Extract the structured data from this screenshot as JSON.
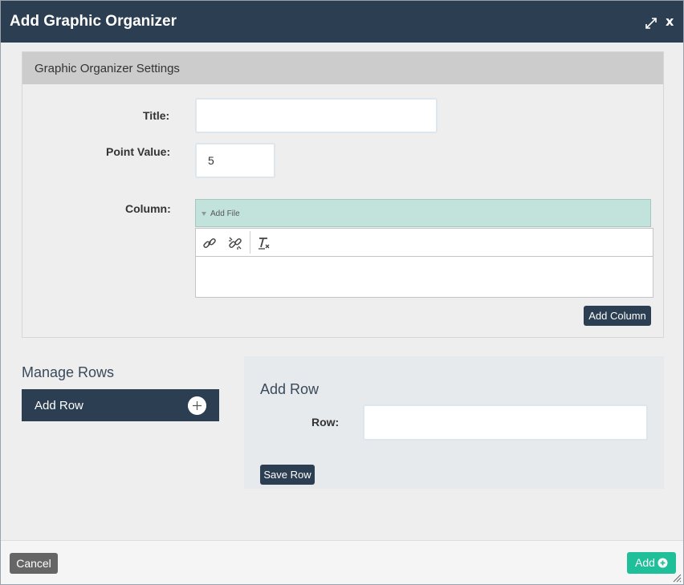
{
  "dialog": {
    "title": "Add Graphic Organizer",
    "close_label": "x"
  },
  "settings": {
    "header": "Graphic Organizer Settings",
    "title_label": "Title:",
    "title_value": "",
    "point_value_label": "Point Value:",
    "point_value": "5",
    "column_label": "Column:",
    "add_file_label": "Add File",
    "editor_tools": [
      "link-icon",
      "unlink-icon",
      "remove-format-icon"
    ],
    "add_column_label": "Add Column"
  },
  "manage_rows": {
    "title": "Manage Rows",
    "add_row_item": "Add Row"
  },
  "add_row_panel": {
    "heading": "Add Row",
    "row_label": "Row:",
    "row_value": "",
    "save_label": "Save Row"
  },
  "footer": {
    "cancel_label": "Cancel",
    "add_label": "Add"
  },
  "colors": {
    "header_bg": "#2c3e52",
    "add_file_bg": "#c2e3db",
    "primary_add": "#1fbf9a",
    "cancel_bg": "#666666"
  }
}
